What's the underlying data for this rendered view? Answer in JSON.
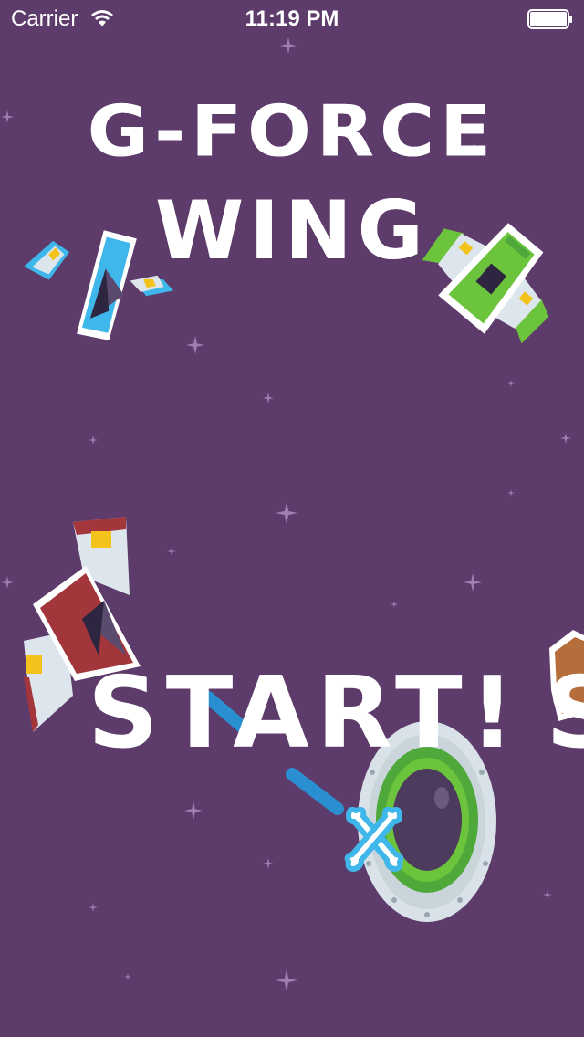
{
  "status_bar": {
    "carrier": "Carrier",
    "time": "11:19 PM"
  },
  "title": {
    "line1": "G-FORCE",
    "line2": "WING"
  },
  "start_button": {
    "label": "START!",
    "partial_label": "S"
  },
  "colors": {
    "background": "#5d3b6a",
    "text": "#ffffff",
    "star": "#b492c4",
    "ship_blue": "#3fb7ea",
    "ship_green": "#6cc43c",
    "ship_red": "#a2363b",
    "ship_orange": "#b46d3b",
    "ship_body": "#dde6ec",
    "ship_accent": "#f3c31c",
    "laser": "#2a8fd1",
    "porthole_ring": "#d9e2e8",
    "porthole_green": "#4fa93a",
    "porthole_dark": "#4c3b5c"
  },
  "sprites": [
    {
      "name": "blue-ship-icon"
    },
    {
      "name": "green-ship-icon"
    },
    {
      "name": "red-ship-icon"
    },
    {
      "name": "orange-ship-icon"
    },
    {
      "name": "porthole-ufo-icon"
    },
    {
      "name": "crossed-bones-icon"
    }
  ]
}
